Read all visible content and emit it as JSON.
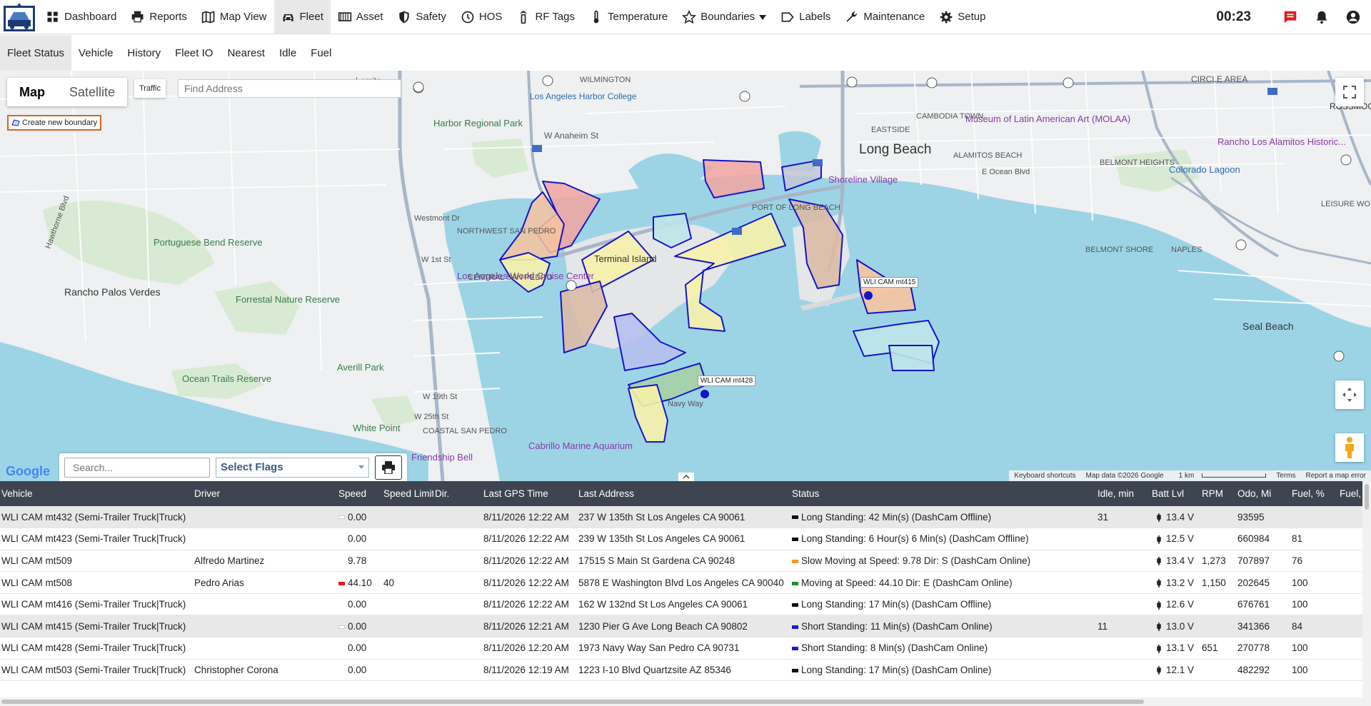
{
  "header": {
    "clock": "00:23",
    "nav": [
      {
        "label": "Dashboard",
        "icon": "grid-icon"
      },
      {
        "label": "Reports",
        "icon": "printer-icon"
      },
      {
        "label": "Map View",
        "icon": "map-icon"
      },
      {
        "label": "Fleet",
        "icon": "car-icon",
        "active": true
      },
      {
        "label": "Asset",
        "icon": "asset-icon"
      },
      {
        "label": "Safety",
        "icon": "shield-icon"
      },
      {
        "label": "HOS",
        "icon": "clock-icon"
      },
      {
        "label": "RF Tags",
        "icon": "rf-tag-icon"
      },
      {
        "label": "Temperature",
        "icon": "thermometer-icon"
      },
      {
        "label": "Boundaries",
        "icon": "star-icon",
        "dropdown": true
      },
      {
        "label": "Labels",
        "icon": "label-icon"
      },
      {
        "label": "Maintenance",
        "icon": "wrench-icon"
      },
      {
        "label": "Setup",
        "icon": "gear-icon"
      }
    ]
  },
  "subnav": [
    "Fleet Status",
    "Vehicle",
    "History",
    "Fleet IO",
    "Nearest",
    "Idle",
    "Fuel"
  ],
  "map": {
    "type_options": [
      "Map",
      "Satellite"
    ],
    "traffic_label": "Traffic",
    "find_address_placeholder": "Find Address",
    "create_boundary_label": "Create new boundary",
    "google_label": "Google",
    "footer": {
      "shortcuts": "Keyboard shortcuts",
      "map_data": "Map data ©2026 Google",
      "scale": "1 km",
      "terms": "Terms",
      "report": "Report a map error"
    },
    "vehicle_labels": [
      "WLI CAM mt415",
      "WLI CAM mt428"
    ],
    "place_labels": [
      "Lomita",
      "WILMINGTON",
      "Los Angeles Harbor College",
      "Harbor Regional Park",
      "W Anaheim St",
      "Westmont Dr",
      "NORTHWEST SAN PEDRO",
      "Portuguese Bend Reserve",
      "Rancho Palos Verdes",
      "Forrestal Nature Reserve",
      "Los Angeles World Cruise Center",
      "W 1st St",
      "Terminal Island",
      "CENTRAL SAN PEDRO",
      "Averill Park",
      "Ocean Trails Reserve",
      "W 19th St",
      "W 25th St",
      "COASTAL SAN PEDRO",
      "White Point",
      "Cabrillo Marine Aquarium",
      "Friendship Bell",
      "Long Beach",
      "PORT OF LONG BEACH",
      "Shoreline Village",
      "Museum of Latin American Art (MOLAA)",
      "ALAMITOS BEACH",
      "E Ocean Blvd",
      "BELMONT HEIGHTS",
      "Colorado Lagoon",
      "Rancho Los Alamitos Historic...",
      "CAMBODIA TOWN",
      "EASTSIDE",
      "Seal Beach",
      "LEISURE WORLD",
      "BELMONT SHORE",
      "NAPLES",
      "ROSSMOOR",
      "CIRCLE AREA",
      "Hawthorne Blvd",
      "Navy Way"
    ]
  },
  "search": {
    "placeholder": "Search...",
    "flags": "Select Flags"
  },
  "table": {
    "columns": [
      "Vehicle",
      "Driver",
      "Speed",
      "Speed Limit",
      "Dir.",
      "Last GPS Time",
      "Last Address",
      "Status",
      "Idle, min",
      "Batt Lvl",
      "RPM",
      "Odo, Mi",
      "Fuel, %",
      "Fuel,"
    ],
    "rows": [
      {
        "vehicle": "WLI CAM mt432 (Semi-Trailer Truck|Truck)",
        "driver": "",
        "speed": "0.00",
        "speed_color": "#ffffff",
        "speed_limit": "",
        "dir": "",
        "gps_time": "8/11/2026 12:22 AM",
        "address": "237 W 135th St Los Angeles CA 90061",
        "status": "Long Standing: 42 Min(s) (DashCam Offline)",
        "status_color": "#111111",
        "idle": "31",
        "batt": "13.4 V",
        "rpm": "",
        "odo": "93595",
        "fuel": ""
      },
      {
        "vehicle": "WLI CAM mt423 (Semi-Trailer Truck|Truck)",
        "driver": "",
        "speed": "0.00",
        "speed_color": "",
        "speed_limit": "",
        "dir": "",
        "gps_time": "8/11/2026 12:22 AM",
        "address": "239 W 135th St Los Angeles CA 90061",
        "status": "Long Standing: 6 Hour(s) 6 Min(s) (DashCam Offline)",
        "status_color": "#111111",
        "idle": "",
        "batt": "12.5 V",
        "rpm": "",
        "odo": "660984",
        "fuel": "81"
      },
      {
        "vehicle": "WLI CAM mt509",
        "driver": "Alfredo Martinez",
        "speed": "9.78",
        "speed_color": "",
        "speed_limit": "",
        "dir": "S",
        "gps_time": "8/11/2026 12:22 AM",
        "address": "17515 S Main St Gardena CA 90248",
        "status": "Slow Moving at Speed: 9.78 Dir: S (DashCam Online)",
        "status_color": "#f59a23",
        "idle": "",
        "batt": "13.4 V",
        "rpm": "1,273",
        "odo": "707897",
        "fuel": "76"
      },
      {
        "vehicle": "WLI CAM mt508",
        "driver": "Pedro Arias",
        "speed": "44.10",
        "speed_color": "#e02020",
        "speed_limit": "40",
        "dir": "E",
        "gps_time": "8/11/2026 12:22 AM",
        "address": "5878 E Washington Blvd Los Angeles CA 90040",
        "status": "Moving at Speed: 44.10 Dir: E (DashCam Online)",
        "status_color": "#1e8e1e",
        "idle": "",
        "batt": "13.2 V",
        "rpm": "1,150",
        "odo": "202645",
        "fuel": "100"
      },
      {
        "vehicle": "WLI CAM mt416 (Semi-Trailer Truck|Truck)",
        "driver": "",
        "speed": "0.00",
        "speed_color": "",
        "speed_limit": "",
        "dir": "",
        "gps_time": "8/11/2026 12:22 AM",
        "address": "162 W 132nd St Los Angeles CA 90061",
        "status": "Long Standing: 17 Min(s) (DashCam Offline)",
        "status_color": "#111111",
        "idle": "",
        "batt": "12.6 V",
        "rpm": "",
        "odo": "676761",
        "fuel": "100"
      },
      {
        "vehicle": "WLI CAM mt415 (Semi-Trailer Truck|Truck)",
        "driver": "",
        "speed": "0.00",
        "speed_color": "#ffffff",
        "speed_limit": "",
        "dir": "",
        "gps_time": "8/11/2026 12:21 AM",
        "address": "1230 Pier G Ave Long Beach CA 90802",
        "status": "Short Standing: 11 Min(s) (DashCam Online)",
        "status_color": "#1a1ad6",
        "idle": "11",
        "batt": "13.0 V",
        "rpm": "",
        "odo": "341366",
        "fuel": "84"
      },
      {
        "vehicle": "WLI CAM mt428 (Semi-Trailer Truck|Truck)",
        "driver": "",
        "speed": "0.00",
        "speed_color": "",
        "speed_limit": "",
        "dir": "",
        "gps_time": "8/11/2026 12:20 AM",
        "address": "1973 Navy Way San Pedro CA 90731",
        "status": "Short Standing: 8 Min(s) (DashCam Online)",
        "status_color": "#1a1ad6",
        "idle": "",
        "batt": "13.1 V",
        "rpm": "651",
        "odo": "270778",
        "fuel": "100"
      },
      {
        "vehicle": "WLI CAM mt503 (Semi-Trailer Truck|Truck)",
        "driver": "Christopher Corona",
        "speed": "0.00",
        "speed_color": "",
        "speed_limit": "",
        "dir": "",
        "gps_time": "8/11/2026 12:19 AM",
        "address": "1223 I-10 Blvd Quartzsite AZ 85346",
        "status": "Long Standing: 17 Min(s) (DashCam Online)",
        "status_color": "#111111",
        "idle": "",
        "batt": "12.1 V",
        "rpm": "",
        "odo": "482292",
        "fuel": "100"
      }
    ]
  }
}
